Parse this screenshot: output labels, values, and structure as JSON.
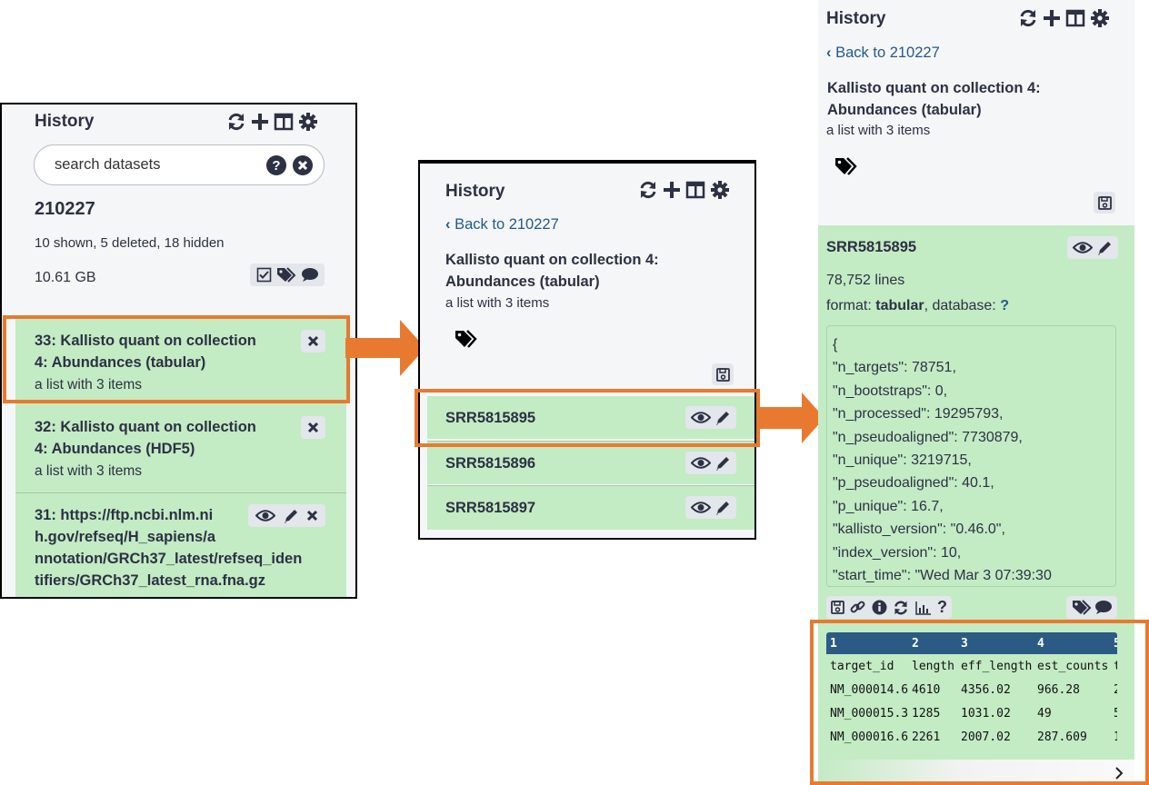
{
  "panel1": {
    "title": "History",
    "search_placeholder": "search datasets",
    "history_name": "210227",
    "counts": "10 shown, 5 deleted, 18 hidden",
    "size": "10.61 GB",
    "items": [
      {
        "title_line1": "33: Kallisto quant on collection",
        "title_line2": "4: Abundances (tabular)",
        "sub": "a list with 3 items"
      },
      {
        "title_line1": "32: Kallisto quant on collection",
        "title_line2": "4: Abundances (HDF5)",
        "sub": "a list with 3 items"
      },
      {
        "title_line1": "31: https://ftp.ncbi.nlm.ni",
        "title_line2": "h.gov/refseq/H_sapiens/a",
        "title_line3": "nnotation/GRCh37_latest/refseq_iden",
        "title_line4": "tifiers/GRCh37_latest_rna.fna.gz"
      }
    ]
  },
  "panel2": {
    "title": "History",
    "back_link": "Back to 210227",
    "collection_title_line1": "Kallisto quant on collection 4:",
    "collection_title_line2": "Abundances (tabular)",
    "collection_sub": "a list with 3 items",
    "elements": [
      "SRR5815895",
      "SRR5815896",
      "SRR5815897"
    ]
  },
  "panel3": {
    "title": "History",
    "back_link": "Back to 210227",
    "collection_title_line1": "Kallisto quant on collection 4:",
    "collection_title_line2": "Abundances (tabular)",
    "collection_sub": "a list with 3 items",
    "dataset": {
      "name": "SRR5815895",
      "lines": "78,752 lines",
      "format_label": "format: ",
      "format_value": "tabular",
      "database_label": ", database: ",
      "database_value": "?",
      "peek": [
        "{",
        "\"n_targets\": 78751,",
        "\"n_bootstraps\": 0,",
        "\"n_processed\": 19295793,",
        "\"n_pseudoaligned\": 7730879,",
        "\"n_unique\": 3219715,",
        "\"p_pseudoaligned\": 40.1,",
        "\"p_unique\": 16.7,",
        "\"kallisto_version\": \"0.46.0\",",
        "\"index_version\": 10,",
        "\"start_time\": \"Wed Mar 3 07:39:30"
      ],
      "table": {
        "column_numbers": [
          "1",
          "2",
          "3",
          "4",
          "5"
        ],
        "header": [
          "target_id",
          "length",
          "eff_length",
          "est_counts",
          "t"
        ],
        "rows": [
          [
            "NM_000014.6",
            "4610",
            "4356.02",
            "966.28",
            "2"
          ],
          [
            "NM_000015.3",
            "1285",
            "1031.02",
            "49",
            "5"
          ],
          [
            "NM_000016.6",
            "2261",
            "2007.02",
            "287.609",
            "1"
          ]
        ]
      }
    }
  },
  "colors": {
    "green": "#c3ebc4",
    "orange": "#e87a30",
    "table_header": "#2b5b84",
    "link": "#24598a"
  }
}
